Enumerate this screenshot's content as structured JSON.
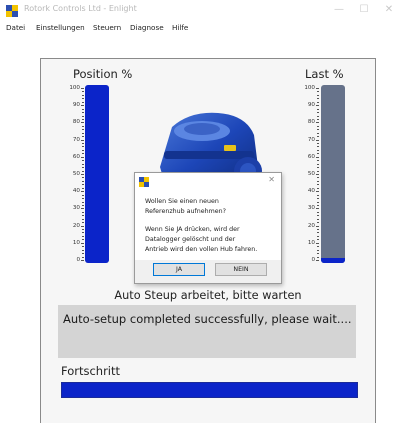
{
  "window": {
    "title": "Rotork Controls Ltd - Enlight"
  },
  "menubar": {
    "items": [
      "Datei",
      "Einstellungen",
      "Steuern",
      "Diagnose",
      "Hilfe"
    ]
  },
  "position_gauge": {
    "title": "Position %",
    "value_percent": 100,
    "fill_color": "#0b24c9"
  },
  "load_gauge": {
    "title": "Last %",
    "value_percent": 3,
    "base_color": "#66728a",
    "fill_color": "#0b24c9"
  },
  "scale_ticks": [
    "100",
    "90",
    "80",
    "70",
    "60",
    "50",
    "40",
    "30",
    "20",
    "10",
    "0"
  ],
  "dialog": {
    "line1": "Wollen Sie einen neuen",
    "line2": "Referenzhub aufnehmen?",
    "line3": "Wenn Sie JA drücken, wird der",
    "line4": "Datalogger gelöscht und der",
    "line5": "Antrieb wird den vollen Hub fahren.",
    "yes_label": "JA",
    "no_label": "NEIN",
    "close_glyph": "✕"
  },
  "status": {
    "heading": "Auto Steup arbeitet, bitte warten",
    "message": "Auto-setup completed successfully, please wait...."
  },
  "progress": {
    "label": "Fortschritt",
    "value_percent": 100
  }
}
